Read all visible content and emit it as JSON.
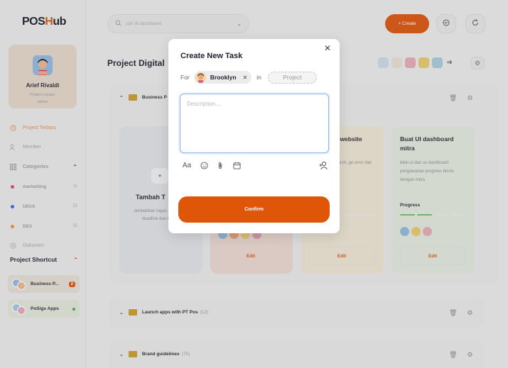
{
  "app": {
    "logo_pre": "POS",
    "logo_o": "H",
    "logo_post": "ub"
  },
  "profile": {
    "name": "Arief Rivaldi",
    "role_line1": "Project creator",
    "role_line2": "admin"
  },
  "nav": {
    "project_terbaru": "Project Terbaru",
    "member": "Member",
    "categories": "Categories",
    "dokumen": "Dokumen"
  },
  "categories": [
    {
      "label": "marketting",
      "count": "11",
      "color": "#d9408f"
    },
    {
      "label": "UI/UX",
      "count": "33",
      "color": "#3f63d9"
    },
    {
      "label": "DEV",
      "count": "55",
      "color": "#e8902f"
    }
  ],
  "shortcuts": {
    "title": "Project Shortcut",
    "items": [
      {
        "label": "Business P...",
        "badge": "2"
      },
      {
        "label": "PoSigs Apps"
      }
    ]
  },
  "topbar": {
    "search_placeholder": "cari di dashboard",
    "create_label": "+  Create"
  },
  "page": {
    "title": "Project Digital",
    "team_more": "+9"
  },
  "project_groups": [
    {
      "name": "Business P",
      "count": ""
    },
    {
      "name": "Launch apps with PT Pos",
      "count": "(12)"
    },
    {
      "name": "Brand guidelines",
      "count": "(75)"
    }
  ],
  "add_card": {
    "plus": "+",
    "title": "Tambah T",
    "desc": "tambahkan tugas member, tetu deadline dan be tugas."
  },
  "cards": [
    {
      "title": "",
      "desc": "",
      "edit": "Edit"
    },
    {
      "title": "n fitur website",
      "desc": "rror di search, ge error dan dengan",
      "edit": "Edit"
    },
    {
      "title": "Buat UI dashboard mitra",
      "desc": "bikin ui dan ux dashboard pengawasan progress bisnis dengan mitra",
      "progress_label": "Progress",
      "progress": 0.5,
      "edit": "Edit"
    }
  ],
  "modal": {
    "title": "Create New Task",
    "for_label": "For",
    "assignee": "Brooklyn",
    "in_label": "in",
    "project_placeholder": "Project",
    "description_placeholder": "Description...",
    "text_format": "Aa",
    "confirm_label": "Confirm"
  }
}
